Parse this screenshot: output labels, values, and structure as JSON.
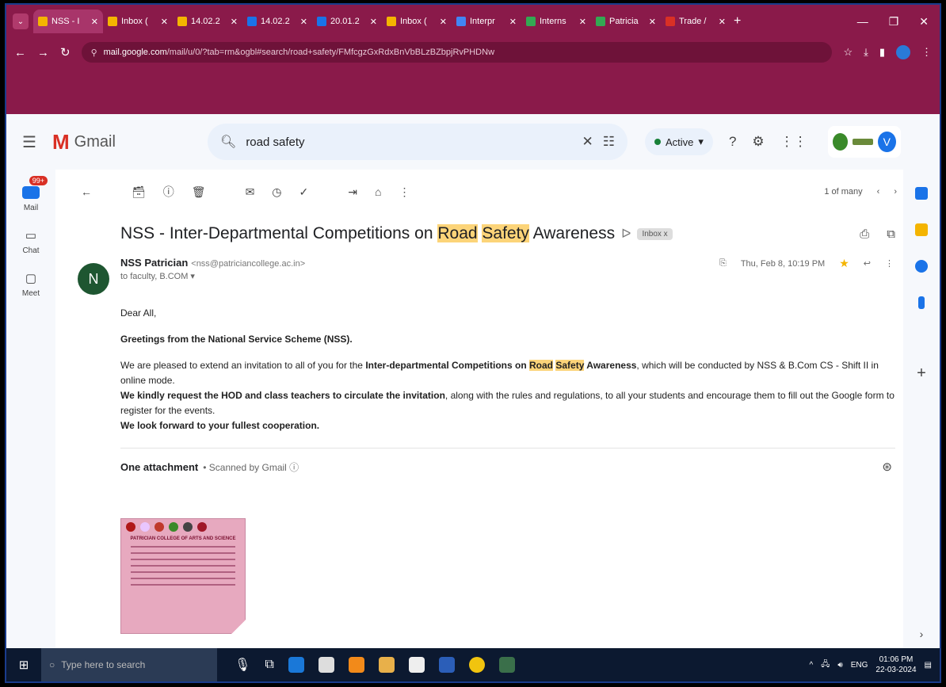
{
  "browser": {
    "tabs": [
      {
        "label": "NSS - I",
        "color": "#f4b400"
      },
      {
        "label": "Inbox (",
        "color": "#f4b400"
      },
      {
        "label": "14.02.2",
        "color": "#f4b400"
      },
      {
        "label": "14.02.2",
        "color": "#1a73e8"
      },
      {
        "label": "20.01.2",
        "color": "#1a73e8"
      },
      {
        "label": "Inbox (",
        "color": "#f4b400"
      },
      {
        "label": "Interpr",
        "color": "#4285f4"
      },
      {
        "label": "Interns",
        "color": "#34a853"
      },
      {
        "label": "Patricia",
        "color": "#34a853"
      },
      {
        "label": "Trade /",
        "color": "#d93025"
      }
    ],
    "new_tab": "+",
    "url_host": "mail.google.com",
    "url_path": "/mail/u/0/?tab=rm&ogbl#search/road+safety/FMfcgzGxRdxBnVbBLzBZbpjRvPHDNw"
  },
  "gmail": {
    "product": "Gmail",
    "search_value": "road safety",
    "status": "Active",
    "avatar_letter": "V"
  },
  "rail": {
    "mail_label": "Mail",
    "mail_badge": "99+",
    "chat_label": "Chat",
    "meet_label": "Meet"
  },
  "pager": "1 of many",
  "email": {
    "subject_pre": "NSS - Inter-Departmental Competitions on ",
    "subject_hl1": "Road",
    "subject_hl2": "Safety",
    "subject_post": " Awareness",
    "inbox_chip": "Inbox x",
    "sender_initial": "N",
    "sender_name": "NSS Patrician",
    "sender_email": "<nss@patriciancollege.ac.in>",
    "to_line": "to faculty, B.COM ▾",
    "date": "Thu, Feb 8, 10:19 PM",
    "greeting": "Dear All,",
    "greeting2": "Greetings from the National Service Scheme (NSS).",
    "p1_a": "We are pleased to extend an invitation to all of you for the ",
    "p1_b": "Inter-departmental Competitions on ",
    "p1_hl1": "Road",
    "p1_hl2": "Safety",
    "p1_c": " Awareness",
    "p1_d": ", which will be conducted by NSS & B.Com CS - Shift II in online mode.",
    "p2_b": "We kindly request the HOD and class teachers to circulate the invitation",
    "p2_c": ", along with the rules and regulations, to all your students and encourage them to fill out the Google form to register for the events.",
    "p3": "We look forward to your fullest cooperation.",
    "attach_title": "One attachment",
    "attach_scanned": "• Scanned by Gmail ⓘ",
    "thumb_title": "PATRICIAN COLLEGE OF ARTS AND SCIENCE"
  },
  "taskbar": {
    "search_placeholder": "Type here to search",
    "lang": "ENG",
    "time": "01:06 PM",
    "date": "22-03-2024"
  }
}
